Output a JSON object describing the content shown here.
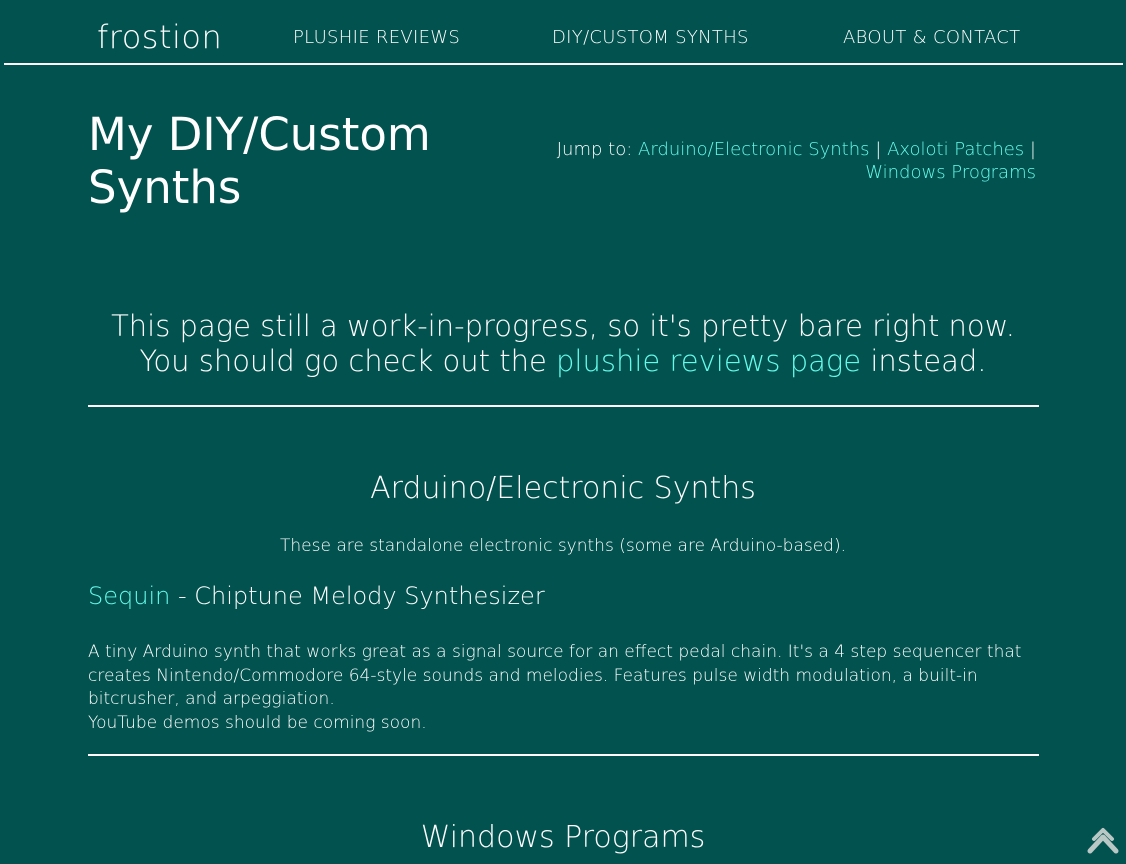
{
  "header": {
    "logo": "frostion",
    "nav": [
      {
        "label": "PLUSHIE REVIEWS"
      },
      {
        "label": "DIY/CUSTOM SYNTHS"
      },
      {
        "label": "ABOUT & CONTACT"
      }
    ]
  },
  "main": {
    "title": "My DIY/Custom Synths",
    "jump": {
      "prefix": "Jump to:",
      "links": [
        "Arduino/Electronic Synths",
        "Axoloti Patches",
        "Windows Programs"
      ],
      "separator": "|"
    },
    "notice": {
      "line1": "This page still a work-in-progress, so it's pretty bare right now.",
      "line2_before": "You should go check out the",
      "line2_link": "plushie reviews page",
      "line2_after": "instead."
    },
    "sections": [
      {
        "heading": "Arduino/Electronic Synths",
        "description": "These are standalone electronic synths (some are Arduino-based).",
        "items": [
          {
            "name": "Sequin",
            "subtitle": "- Chiptune Melody Synthesizer",
            "body": "A tiny Arduino synth that works great as a signal source for an effect pedal chain. It's a 4 step sequencer that creates Nintendo/Commodore 64-style sounds and melodies. Features pulse width modulation, a built-in bitcrusher, and arpeggiation.",
            "note": "YouTube demos should be coming soon."
          }
        ]
      },
      {
        "heading": "Windows Programs"
      }
    ]
  },
  "scroll_top": {
    "icon": "chevron-up-icon"
  },
  "colors": {
    "background": "#02524f",
    "text": "#ffffff",
    "link": "#66fbe9"
  }
}
